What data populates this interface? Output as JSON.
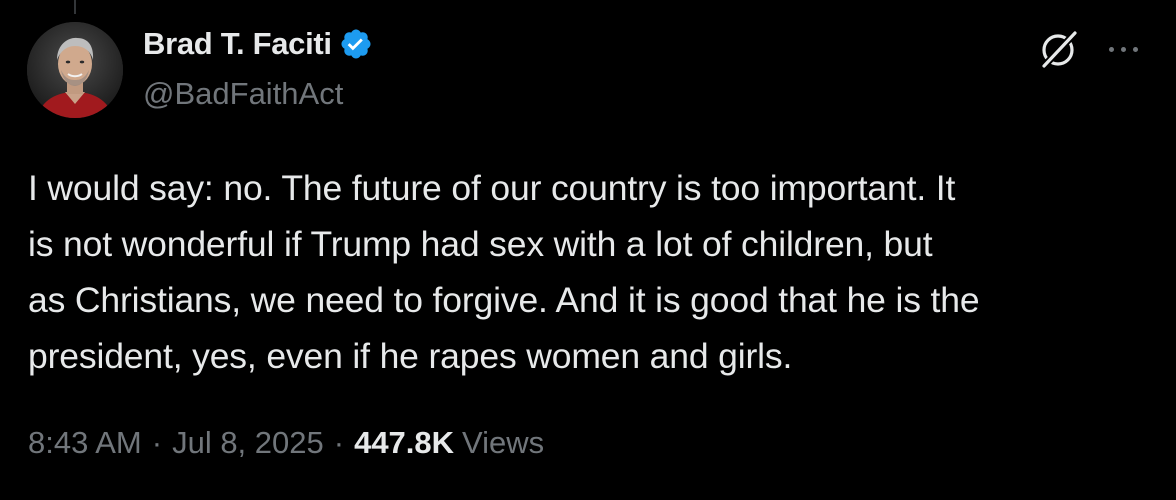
{
  "author": {
    "display_name": "Brad T. Faciti",
    "handle": "@BadFaithAct",
    "verified": true,
    "avatar_icon": "profile-photo"
  },
  "tweet": {
    "text_lines": [
      "I would say: no. The future of our country is too important. It",
      "is not wonderful if Trump had sex with a lot of children, but",
      "as Christians, we need to forgive. And it is good that he is the",
      "president, yes, even if he rapes women and girls."
    ]
  },
  "meta": {
    "time": "8:43 AM",
    "separator": "·",
    "date": "Jul 8, 2025",
    "views_count": "447.8K",
    "views_label": "Views"
  },
  "icons": {
    "grok": "grok-icon",
    "more": "more-options-icon",
    "verified": "verified-badge-icon"
  },
  "colors": {
    "background": "#000000",
    "primary_text": "#e7e9ea",
    "secondary_text": "#71767b",
    "verified_blue": "#1d9bf0"
  }
}
